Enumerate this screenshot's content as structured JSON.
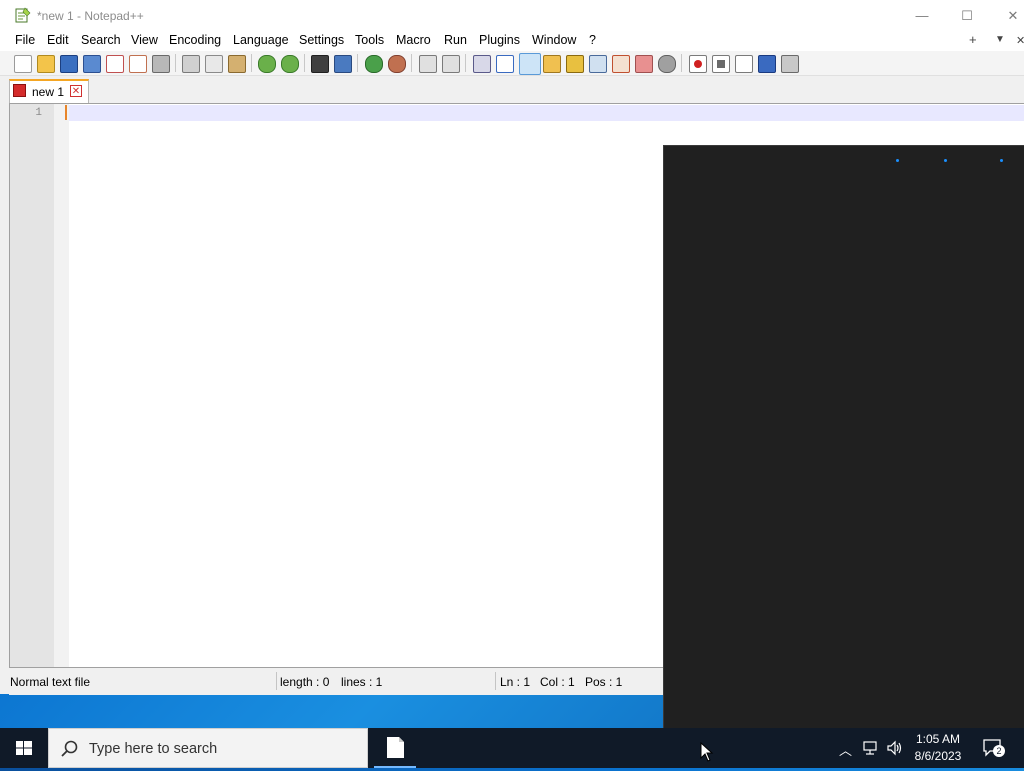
{
  "window": {
    "title": "*new 1 - Notepad++",
    "minimize": "—",
    "maximize": "☐",
    "close": "✕"
  },
  "menu": {
    "items": [
      "File",
      "Edit",
      "Search",
      "View",
      "Encoding",
      "Language",
      "Settings",
      "Tools",
      "Macro",
      "Run",
      "Plugins",
      "Window",
      "?"
    ],
    "add": "+",
    "dropdown": "▼",
    "close": "✕"
  },
  "toolbar": {
    "icons": [
      "new-file-icon",
      "open-file-icon",
      "save-icon",
      "save-all-icon",
      "close-icon",
      "close-all-icon",
      "print-icon",
      "cut-icon",
      "copy-icon",
      "paste-icon",
      "undo-icon",
      "redo-icon",
      "find-icon",
      "replace-icon",
      "zoom-in-icon",
      "zoom-out-icon",
      "sync-vertical-icon",
      "sync-horizontal-icon",
      "word-wrap-icon",
      "show-all-chars-icon",
      "indent-guide-icon",
      "user-lang-icon",
      "doc-map-icon",
      "function-list-icon",
      "folder-workspace-icon",
      "monitoring-icon",
      "record-macro-icon",
      "stop-macro-icon",
      "play-macro-icon",
      "run-macro-multiple-icon",
      "save-macro-icon"
    ]
  },
  "tab": {
    "label": "new 1",
    "close": "✕"
  },
  "editor": {
    "line_number": "1"
  },
  "status": {
    "file_type": "Normal text file",
    "length": "length : 0",
    "lines": "lines : 1",
    "ln": "Ln : 1",
    "col": "Col : 1",
    "pos": "Pos : 1"
  },
  "taskbar": {
    "search_placeholder": "Type here to search",
    "time": "1:05 AM",
    "date": "8/6/2023",
    "notifications": "2"
  },
  "colors": {
    "tab_accent": "#f5a623",
    "current_line": "#e8e8ff",
    "dark_panel": "#202020",
    "taskbar": "#101a28"
  }
}
